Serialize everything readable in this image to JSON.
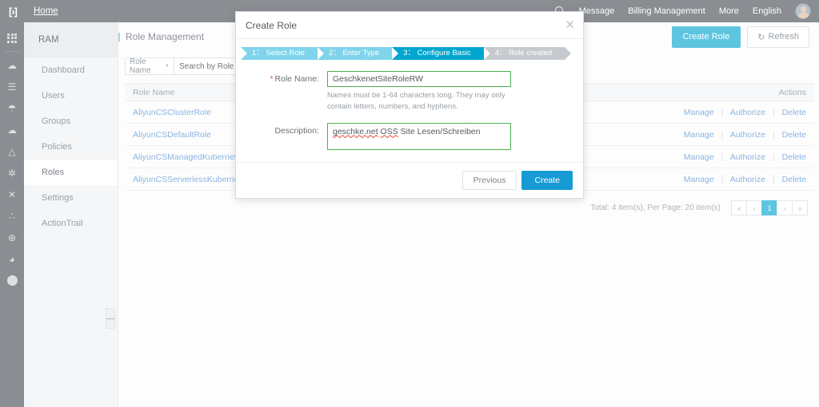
{
  "topbar": {
    "logo_icon": "brackets-logo-icon",
    "home_label": "Home",
    "search_icon": "search-icon",
    "links": [
      {
        "label": "Message"
      },
      {
        "label": "Billing Management"
      },
      {
        "label": "More"
      },
      {
        "label": "English"
      }
    ],
    "avatar_icon": "user-avatar"
  },
  "rail": {
    "icons": [
      {
        "name": "app-grid-icon",
        "glyph": ""
      },
      {
        "name": "cloud-service-icon",
        "glyph": "☁"
      },
      {
        "name": "server-stack-icon",
        "glyph": "☰"
      },
      {
        "name": "shield-icon",
        "glyph": "☙"
      },
      {
        "name": "cloud-storage-icon",
        "glyph": "☁"
      },
      {
        "name": "cloud-upload-icon",
        "glyph": "△"
      },
      {
        "name": "network-icon",
        "glyph": "✲"
      },
      {
        "name": "cross-tools-icon",
        "glyph": "✕"
      },
      {
        "name": "share-nodes-icon",
        "glyph": "∴"
      },
      {
        "name": "globe-icon",
        "glyph": "⊕"
      },
      {
        "name": "database-icon",
        "glyph": "◔"
      }
    ]
  },
  "sidebar": {
    "header": "RAM",
    "items": [
      {
        "label": "Dashboard",
        "active": false
      },
      {
        "label": "Users",
        "active": false
      },
      {
        "label": "Groups",
        "active": false
      },
      {
        "label": "Policies",
        "active": false
      },
      {
        "label": "Roles",
        "active": true
      },
      {
        "label": "Settings",
        "active": false
      },
      {
        "label": "ActionTrail",
        "active": false
      }
    ]
  },
  "page": {
    "breadcrumb": "Role Management",
    "create_role_label": "Create Role",
    "refresh_label": "Refresh",
    "refresh_icon": "refresh-icon"
  },
  "filter": {
    "select_value": "Role Name",
    "caret_icon": "chevron-down-icon",
    "search_placeholder": "Search by Role Name",
    "search_value": ""
  },
  "table": {
    "headers": {
      "role_name": "Role Name",
      "actions": "Actions"
    },
    "action_labels": {
      "manage": "Manage",
      "authorize": "Authorize",
      "delete": "Delete"
    },
    "separator": "|",
    "rows": [
      {
        "role_name": "AliyunCSClusterRole"
      },
      {
        "role_name": "AliyunCSDefaultRole"
      },
      {
        "role_name": "AliyunCSManagedKubernetesRole"
      },
      {
        "role_name": "AliyunCSServerlessKubernetesRo..."
      }
    ]
  },
  "pagination": {
    "summary": "Total: 4 item(s), Per Page: 20 item(s)",
    "first": "«",
    "prev": "‹",
    "current": "1",
    "next": "›",
    "last": "»"
  },
  "modal": {
    "title": "Create Role",
    "close_icon": "close-icon",
    "steps": [
      {
        "label": "1： Select Role",
        "state": "done"
      },
      {
        "label": "2： Enter Type",
        "state": "done"
      },
      {
        "label": "3： Configure Basic",
        "state": "active"
      },
      {
        "label": "4： Role created",
        "state": "todo"
      }
    ],
    "role_name": {
      "required_marker": "*",
      "label": "Role Name:",
      "value": "GeschkenetSiteRoleRW",
      "hint": "Names must be 1-64 characters long. They may only contain letters, numbers, and hyphens."
    },
    "description": {
      "label": "Description:",
      "value_parts": [
        {
          "text": "geschke.net",
          "spellcheck_error": true
        },
        {
          "text": " ",
          "spellcheck_error": false
        },
        {
          "text": "OSS",
          "spellcheck_error": true
        },
        {
          "text": " Site Lesen/Schreiben",
          "spellcheck_error": false
        }
      ],
      "value": "geschke.net OSS Site Lesen/Schreiben"
    },
    "buttons": {
      "previous": "Previous",
      "create": "Create"
    }
  },
  "colors": {
    "topbar_gray": "#8a8d91",
    "accent_cyan": "#5ec5e0",
    "step_done": "#7fd4ec",
    "step_active": "#00a6d0",
    "step_todo": "#c6cace",
    "create_blue": "#169bd5",
    "valid_green": "#4caf50",
    "required_red": "#e8574a",
    "link_blue": "#8cb4e2"
  }
}
